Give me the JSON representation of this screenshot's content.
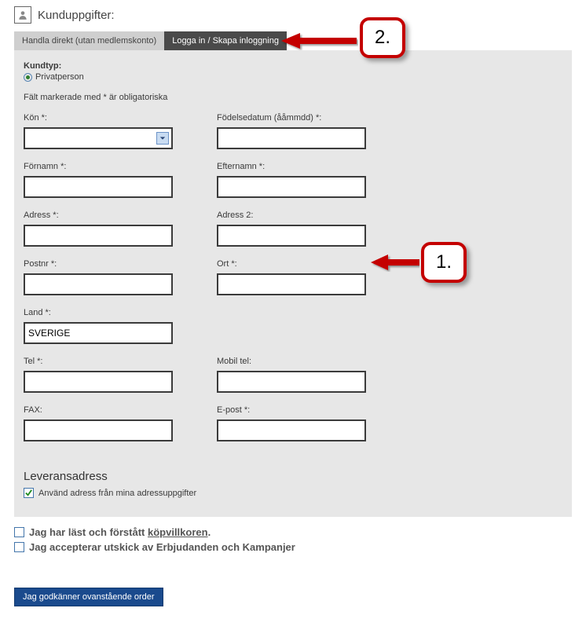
{
  "header": {
    "title": "Kunduppgifter:"
  },
  "tabs": {
    "direct": "Handla direkt (utan medlemskonto)",
    "login": "Logga in / Skapa inloggning"
  },
  "form": {
    "kundtyp_label": "Kundtyp:",
    "kundtyp_option": "Privatperson",
    "required_hint": "Fält markerade med * är obligatoriska",
    "kon": "Kön *:",
    "fodelsedatum": "Födelsedatum (ååmmdd) *:",
    "fornamn": "Förnamn *:",
    "efternamn": "Efternamn *:",
    "adress": "Adress *:",
    "adress2": "Adress 2:",
    "postnr": "Postnr *:",
    "ort": "Ort *:",
    "land": "Land *:",
    "land_value": "SVERIGE",
    "tel": "Tel *:",
    "mobil": "Mobil tel:",
    "fax": "FAX:",
    "epost": "E-post *:",
    "leverans_title": "Leveransadress",
    "use_address": "Använd adress från mina adressuppgifter"
  },
  "agreements": {
    "terms_prefix": "Jag har läst och förstått ",
    "terms_link": "köpvillkoren",
    "terms_suffix": ".",
    "offers": "Jag accepterar utskick av Erbjudanden och Kampanjer"
  },
  "submit": "Jag godkänner ovanstående order",
  "annotations": {
    "one": "1.",
    "two": "2."
  }
}
